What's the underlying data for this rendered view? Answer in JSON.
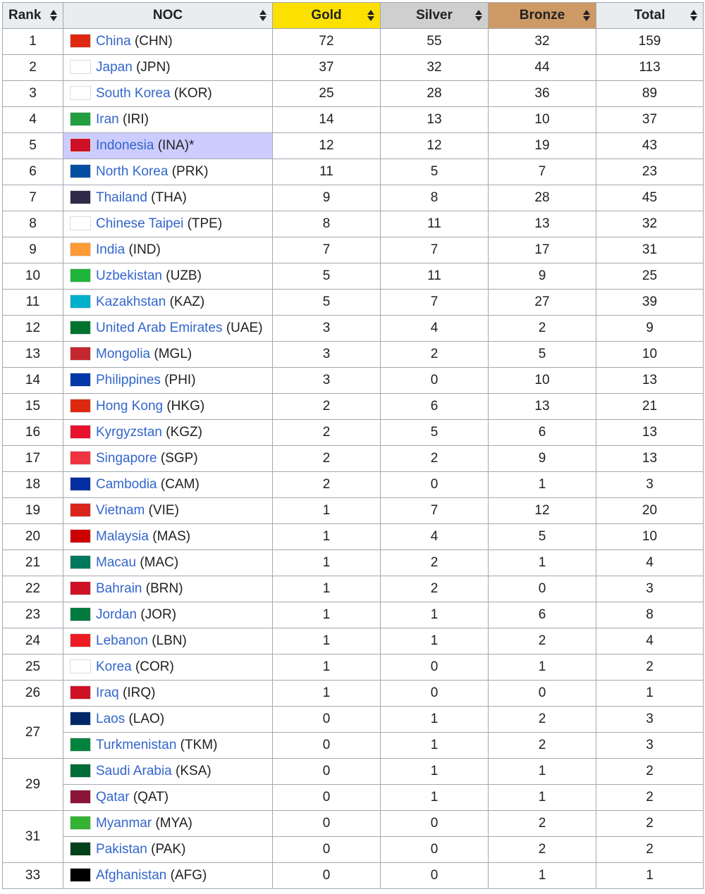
{
  "headers": {
    "rank": "Rank",
    "noc": "NOC",
    "gold": "Gold",
    "silver": "Silver",
    "bronze": "Bronze",
    "total": "Total"
  },
  "colors": {
    "gold": "#fce000",
    "silver": "#cfcfcf",
    "bronze": "#cd9a66",
    "host": "#ccccff",
    "link": "#3366cc"
  },
  "rows": [
    {
      "rank": "1",
      "rankspan": 1,
      "name": "China",
      "code": "(CHN)",
      "flag": "#de2910",
      "gold": "72",
      "silver": "55",
      "bronze": "32",
      "total": "159"
    },
    {
      "rank": "2",
      "rankspan": 1,
      "name": "Japan",
      "code": "(JPN)",
      "flag": "#ffffff",
      "gold": "37",
      "silver": "32",
      "bronze": "44",
      "total": "113"
    },
    {
      "rank": "3",
      "rankspan": 1,
      "name": "South Korea",
      "code": "(KOR)",
      "flag": "#ffffff",
      "gold": "25",
      "silver": "28",
      "bronze": "36",
      "total": "89"
    },
    {
      "rank": "4",
      "rankspan": 1,
      "name": "Iran",
      "code": "(IRI)",
      "flag": "#239f40",
      "gold": "14",
      "silver": "13",
      "bronze": "10",
      "total": "37"
    },
    {
      "rank": "5",
      "rankspan": 1,
      "name": "Indonesia",
      "code": "(INA)*",
      "flag": "#ce1126",
      "host": true,
      "gold": "12",
      "silver": "12",
      "bronze": "19",
      "total": "43"
    },
    {
      "rank": "6",
      "rankspan": 1,
      "name": "North Korea",
      "code": "(PRK)",
      "flag": "#024fa2",
      "gold": "11",
      "silver": "5",
      "bronze": "7",
      "total": "23"
    },
    {
      "rank": "7",
      "rankspan": 1,
      "name": "Thailand",
      "code": "(THA)",
      "flag": "#2d2a4a",
      "gold": "9",
      "silver": "8",
      "bronze": "28",
      "total": "45"
    },
    {
      "rank": "8",
      "rankspan": 1,
      "name": "Chinese Taipei",
      "code": "(TPE)",
      "flag": "#ffffff",
      "gold": "8",
      "silver": "11",
      "bronze": "13",
      "total": "32"
    },
    {
      "rank": "9",
      "rankspan": 1,
      "name": "India",
      "code": "(IND)",
      "flag": "#ff9933",
      "gold": "7",
      "silver": "7",
      "bronze": "17",
      "total": "31"
    },
    {
      "rank": "10",
      "rankspan": 1,
      "name": "Uzbekistan",
      "code": "(UZB)",
      "flag": "#1eb53a",
      "gold": "5",
      "silver": "11",
      "bronze": "9",
      "total": "25"
    },
    {
      "rank": "11",
      "rankspan": 1,
      "name": "Kazakhstan",
      "code": "(KAZ)",
      "flag": "#00afca",
      "gold": "5",
      "silver": "7",
      "bronze": "27",
      "total": "39"
    },
    {
      "rank": "12",
      "rankspan": 1,
      "name": "United Arab Emirates",
      "code": "(UAE)",
      "flag": "#00732f",
      "gold": "3",
      "silver": "4",
      "bronze": "2",
      "total": "9"
    },
    {
      "rank": "13",
      "rankspan": 1,
      "name": "Mongolia",
      "code": "(MGL)",
      "flag": "#c4272f",
      "gold": "3",
      "silver": "2",
      "bronze": "5",
      "total": "10"
    },
    {
      "rank": "14",
      "rankspan": 1,
      "name": "Philippines",
      "code": "(PHI)",
      "flag": "#0038a8",
      "gold": "3",
      "silver": "0",
      "bronze": "10",
      "total": "13"
    },
    {
      "rank": "15",
      "rankspan": 1,
      "name": "Hong Kong",
      "code": "(HKG)",
      "flag": "#de2910",
      "gold": "2",
      "silver": "6",
      "bronze": "13",
      "total": "21"
    },
    {
      "rank": "16",
      "rankspan": 1,
      "name": "Kyrgyzstan",
      "code": "(KGZ)",
      "flag": "#e8112d",
      "gold": "2",
      "silver": "5",
      "bronze": "6",
      "total": "13"
    },
    {
      "rank": "17",
      "rankspan": 1,
      "name": "Singapore",
      "code": "(SGP)",
      "flag": "#ef3340",
      "gold": "2",
      "silver": "2",
      "bronze": "9",
      "total": "13"
    },
    {
      "rank": "18",
      "rankspan": 1,
      "name": "Cambodia",
      "code": "(CAM)",
      "flag": "#032ea1",
      "gold": "2",
      "silver": "0",
      "bronze": "1",
      "total": "3"
    },
    {
      "rank": "19",
      "rankspan": 1,
      "name": "Vietnam",
      "code": "(VIE)",
      "flag": "#da251d",
      "gold": "1",
      "silver": "7",
      "bronze": "12",
      "total": "20"
    },
    {
      "rank": "20",
      "rankspan": 1,
      "name": "Malaysia",
      "code": "(MAS)",
      "flag": "#cc0001",
      "gold": "1",
      "silver": "4",
      "bronze": "5",
      "total": "10"
    },
    {
      "rank": "21",
      "rankspan": 1,
      "name": "Macau",
      "code": "(MAC)",
      "flag": "#00785e",
      "gold": "1",
      "silver": "2",
      "bronze": "1",
      "total": "4"
    },
    {
      "rank": "22",
      "rankspan": 1,
      "name": "Bahrain",
      "code": "(BRN)",
      "flag": "#ce1126",
      "gold": "1",
      "silver": "2",
      "bronze": "0",
      "total": "3"
    },
    {
      "rank": "23",
      "rankspan": 1,
      "name": "Jordan",
      "code": "(JOR)",
      "flag": "#007a3d",
      "gold": "1",
      "silver": "1",
      "bronze": "6",
      "total": "8"
    },
    {
      "rank": "24",
      "rankspan": 1,
      "name": "Lebanon",
      "code": "(LBN)",
      "flag": "#ed1c24",
      "gold": "1",
      "silver": "1",
      "bronze": "2",
      "total": "4"
    },
    {
      "rank": "25",
      "rankspan": 1,
      "name": "Korea",
      "code": "(COR)",
      "flag": "#ffffff",
      "gold": "1",
      "silver": "0",
      "bronze": "1",
      "total": "2"
    },
    {
      "rank": "26",
      "rankspan": 1,
      "name": "Iraq",
      "code": "(IRQ)",
      "flag": "#ce1126",
      "gold": "1",
      "silver": "0",
      "bronze": "0",
      "total": "1"
    },
    {
      "rank": "27",
      "rankspan": 2,
      "name": "Laos",
      "code": "(LAO)",
      "flag": "#002868",
      "gold": "0",
      "silver": "1",
      "bronze": "2",
      "total": "3"
    },
    {
      "rank": "",
      "rankspan": 0,
      "name": "Turkmenistan",
      "code": "(TKM)",
      "flag": "#00843d",
      "gold": "0",
      "silver": "1",
      "bronze": "2",
      "total": "3"
    },
    {
      "rank": "29",
      "rankspan": 2,
      "name": "Saudi Arabia",
      "code": "(KSA)",
      "flag": "#006c35",
      "gold": "0",
      "silver": "1",
      "bronze": "1",
      "total": "2"
    },
    {
      "rank": "",
      "rankspan": 0,
      "name": "Qatar",
      "code": "(QAT)",
      "flag": "#8a1538",
      "gold": "0",
      "silver": "1",
      "bronze": "1",
      "total": "2"
    },
    {
      "rank": "31",
      "rankspan": 2,
      "name": "Myanmar",
      "code": "(MYA)",
      "flag": "#34b233",
      "gold": "0",
      "silver": "0",
      "bronze": "2",
      "total": "2"
    },
    {
      "rank": "",
      "rankspan": 0,
      "name": "Pakistan",
      "code": "(PAK)",
      "flag": "#01411c",
      "gold": "0",
      "silver": "0",
      "bronze": "2",
      "total": "2"
    },
    {
      "rank": "33",
      "rankspan": 1,
      "name": "Afghanistan",
      "code": "(AFG)",
      "flag": "#000000",
      "gold": "0",
      "silver": "0",
      "bronze": "1",
      "total": "1"
    }
  ]
}
